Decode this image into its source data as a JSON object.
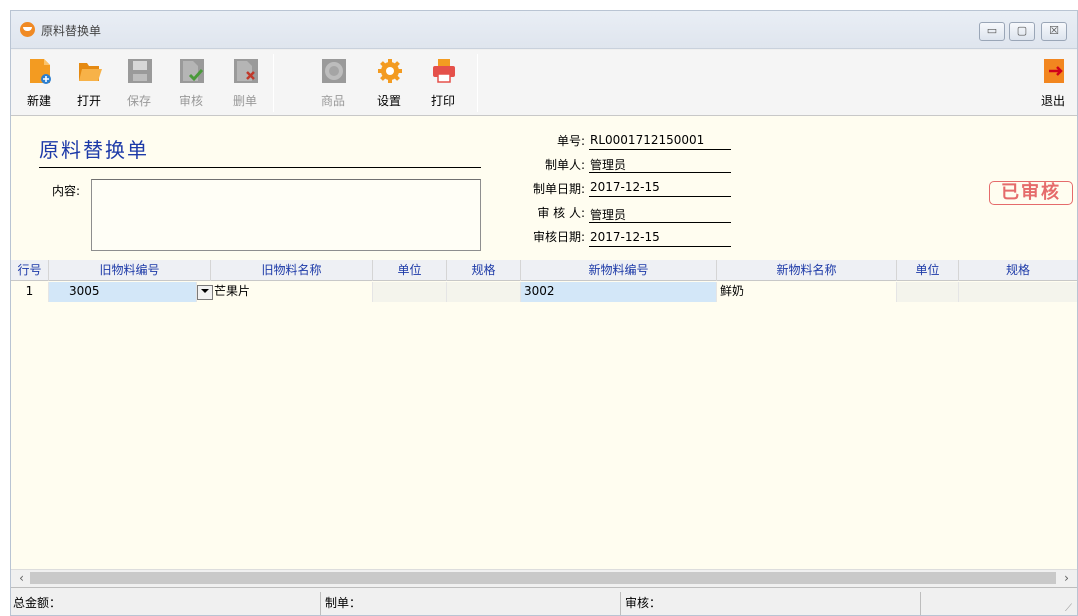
{
  "window": {
    "title": "原料替换单",
    "min_glyph": "▭",
    "max_glyph": "▢",
    "close_glyph": "☒"
  },
  "toolbar": {
    "items": [
      {
        "label": "新建",
        "icon": "new-doc-icon",
        "enabled": true
      },
      {
        "label": "打开",
        "icon": "open-folder-icon",
        "enabled": true
      },
      {
        "label": "保存",
        "icon": "save-icon",
        "enabled": false
      },
      {
        "label": "审核",
        "icon": "approve-icon",
        "enabled": false
      },
      {
        "label": "删单",
        "icon": "delete-doc-icon",
        "enabled": false
      },
      {
        "label": "商品",
        "icon": "goods-icon",
        "enabled": false
      },
      {
        "label": "设置",
        "icon": "gear-icon",
        "enabled": true
      },
      {
        "label": "打印",
        "icon": "printer-icon",
        "enabled": true
      }
    ],
    "exit_label": "退出"
  },
  "header": {
    "doc_title": "原料替换单",
    "content_label": "内容:",
    "content_value": "",
    "fields": [
      {
        "label": "单号:",
        "value": "RL0001712150001"
      },
      {
        "label": "制单人:",
        "value": "管理员"
      },
      {
        "label": "制单日期:",
        "value": "2017-12-15"
      },
      {
        "label": "审 核 人:",
        "value": "管理员"
      },
      {
        "label": "审核日期:",
        "value": "2017-12-15"
      }
    ],
    "stamp": "已审核"
  },
  "grid": {
    "columns": [
      "行号",
      "旧物料编号",
      "旧物料名称",
      "单位",
      "规格",
      "新物料编号",
      "新物料名称",
      "单位",
      "规格"
    ],
    "rows": [
      {
        "no": "1",
        "old_code": "3005",
        "old_name": "芒果片",
        "old_unit": "",
        "old_spec": "",
        "new_code": "3002",
        "new_name": "鲜奶",
        "new_unit": "",
        "new_spec": ""
      }
    ]
  },
  "statusbar": {
    "total_label": "总金额：",
    "maker_label": "制单：",
    "auditor_label": "审核："
  },
  "colors": {
    "accent": "#1d3aa8",
    "stamp": "#e56b6b",
    "form_bg": "#fffdf0"
  }
}
